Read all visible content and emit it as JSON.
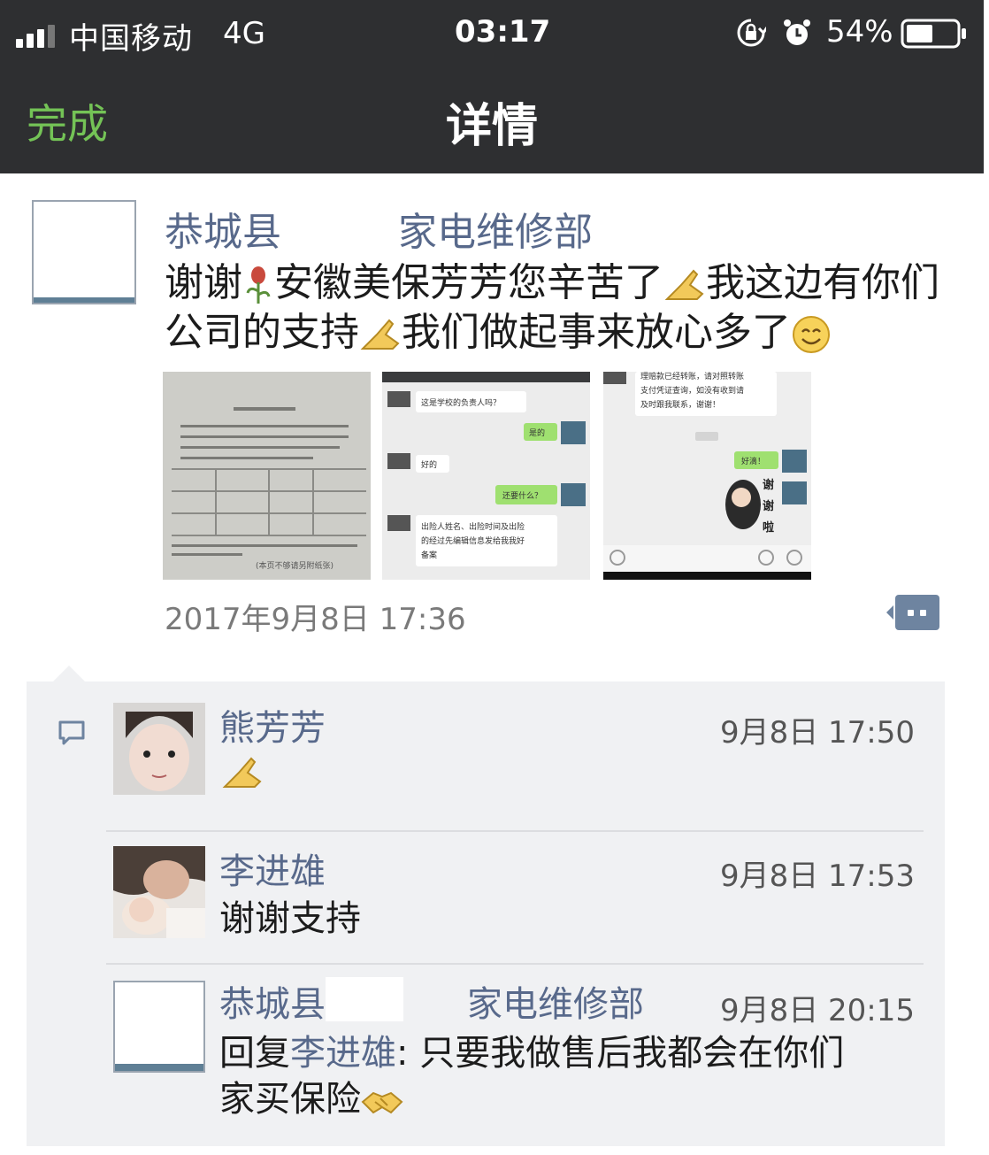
{
  "status_bar": {
    "carrier": "中国移动",
    "network": "4G",
    "time": "03:17",
    "battery_percent": "54%",
    "battery_level": 0.54,
    "icons": [
      "signal-icon",
      "rotation-lock-icon",
      "alarm-icon",
      "battery-icon"
    ]
  },
  "nav": {
    "done_label": "完成",
    "title": "详情"
  },
  "post": {
    "author": "恭城县　　　家电维修部",
    "text_part1": "谢谢",
    "text_part2": "安徽美保芳芳您辛苦了",
    "text_part3": "我这边有你们公司的支持",
    "text_part4": "我们做起事来放心多了",
    "images": [
      {
        "kind": "document-photo",
        "lines": [
          "(本页不够请另附纸张)"
        ]
      },
      {
        "kind": "chat-screenshot",
        "lines": [
          "这是学校的负责人吗？",
          "是的",
          "好的",
          "还要什么？",
          "出险人姓名、出险时间及出险的经过先编辑信息发给我我好备案"
        ]
      },
      {
        "kind": "chat-screenshot",
        "lines": [
          "理赔款已经转账，请对照转账",
          "支付凭证查询，如没有收到请",
          "及时跟我联系，谢谢！",
          "好滴！",
          "谢谢啦"
        ]
      }
    ],
    "timestamp": "2017年9月8日 17:36"
  },
  "comments": [
    {
      "name": "熊芳芳",
      "time": "9月8日 17:50",
      "text": "",
      "emoji": "thumbs-up-emoji"
    },
    {
      "name": "李进雄",
      "time": "9月8日 17:53",
      "text": "谢谢支持"
    },
    {
      "name": "恭城县　　　　家电维修部",
      "time": "9月8日 20:15",
      "reply_prefix": "回复",
      "reply_to": "李进雄",
      "text_line1": ": 只要我做售后我都会在你们",
      "text_line2": "家买保险"
    }
  ],
  "colors": {
    "topbar": "#2e2f31",
    "done": "#74c356",
    "name_link": "#58698b",
    "comment_bg": "#f0f1f3"
  }
}
